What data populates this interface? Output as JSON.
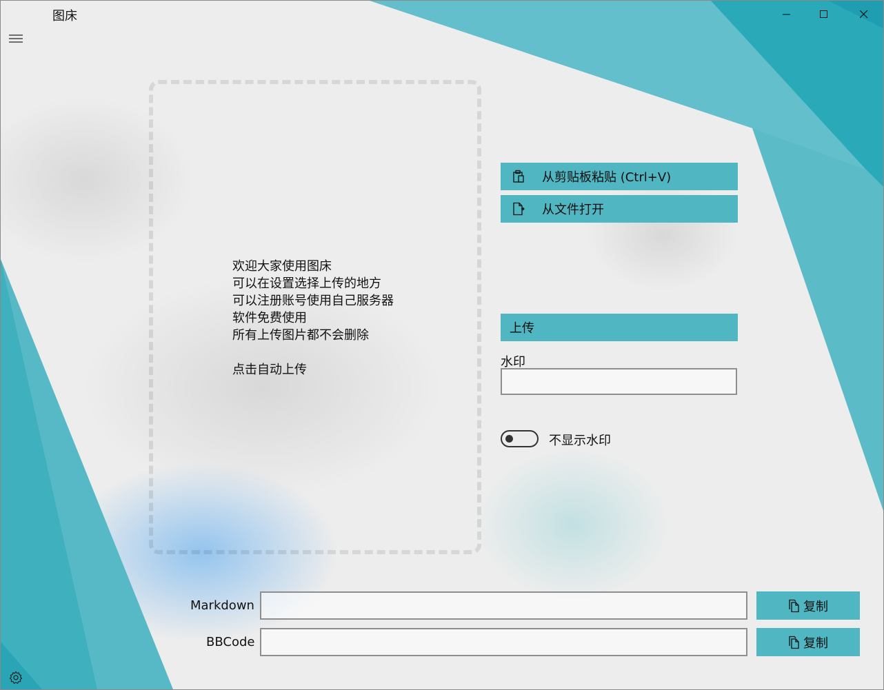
{
  "window": {
    "title": "图床"
  },
  "icons": {
    "menu": "hamburger-icon",
    "minimize": "minimize-icon",
    "maximize": "maximize-icon",
    "close": "close-icon",
    "clipboard": "clipboard-icon",
    "file_open": "file-open-icon",
    "copy": "copy-icon",
    "settings": "gear-icon"
  },
  "dropzone": {
    "lines": [
      "欢迎大家使用图床",
      "可以在设置选择上传的地方",
      "可以注册账号使用自己服务器",
      "软件免费使用",
      "所有上传图片都不会删除"
    ],
    "hint": "点击自动上传"
  },
  "actions": {
    "paste_label": "从剪贴板粘贴 (Ctrl+V)",
    "open_file_label": "从文件打开",
    "upload_label": "上传"
  },
  "watermark": {
    "label": "水印",
    "value": "",
    "toggle_label": "不显示水印",
    "toggle_on": false
  },
  "outputs": {
    "markdown_label": "Markdown",
    "markdown_value": "",
    "bbcode_label": "BBCode",
    "bbcode_value": "",
    "copy_label": "复制"
  },
  "colors": {
    "accent": "#4fb6c2",
    "accent_dark": "#1aa2b2",
    "background": "#ededed"
  }
}
